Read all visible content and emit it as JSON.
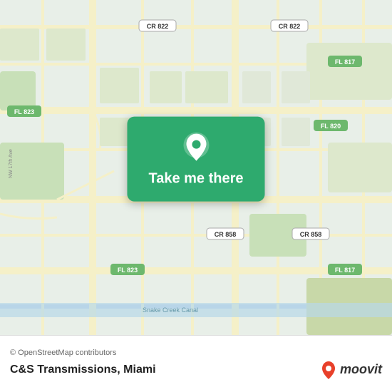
{
  "map": {
    "background_color": "#e8efe8",
    "attribution": "© OpenStreetMap contributors"
  },
  "cta": {
    "label": "Take me there",
    "button_color": "#2eaa6e"
  },
  "bottom_bar": {
    "attribution": "© OpenStreetMap contributors",
    "place_name": "C&S Transmissions, Miami",
    "moovit_text": "moovit"
  }
}
